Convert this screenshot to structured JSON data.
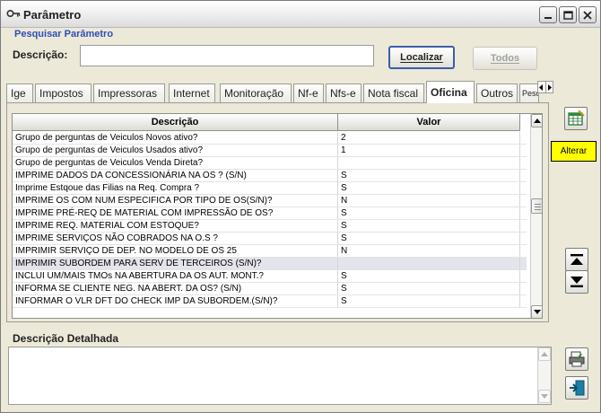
{
  "window": {
    "title": "Parâmetro",
    "icon": "key-icon"
  },
  "search": {
    "section_label": "Pesquisar Parâmetro",
    "description_label": "Descrição:",
    "description_value": "",
    "localizar_label": "Localizar",
    "todos_label": "Todos"
  },
  "tabs": [
    {
      "label": "Ige"
    },
    {
      "label": "Impostos"
    },
    {
      "label": "Impressoras"
    },
    {
      "label": "Internet"
    },
    {
      "label": "Monitoração"
    },
    {
      "label": "Nf-e"
    },
    {
      "label": "Nfs-e"
    },
    {
      "label": "Nota fiscal"
    },
    {
      "label": "Oficina"
    },
    {
      "label": "Outros"
    },
    {
      "label": "Pesqu"
    }
  ],
  "active_tab": "Oficina",
  "grid": {
    "columns": [
      "Descrição",
      "Valor"
    ],
    "rows": [
      {
        "descricao": "Grupo de perguntas de Veiculos Novos ativo?",
        "valor": "2"
      },
      {
        "descricao": "Grupo de perguntas de Veiculos Usados ativo?",
        "valor": "1"
      },
      {
        "descricao": "Grupo de perguntas de Veiculos Venda Direta?",
        "valor": ""
      },
      {
        "descricao": "IMPRIME DADOS DA CONCESSIONÁRIA NA OS ? (S/N)",
        "valor": "S"
      },
      {
        "descricao": "Imprime Estqoue das Filias na Req. Compra ?",
        "valor": "S"
      },
      {
        "descricao": "IMPRIME OS COM NUM ESPECIFICA POR TIPO DE OS(S/N)?",
        "valor": "N"
      },
      {
        "descricao": "IMPRIME PRÉ-REQ DE MATERIAL COM IMPRESSÃO DE OS?",
        "valor": "S"
      },
      {
        "descricao": "IMPRIME REQ. MATERIAL COM ESTOQUE?",
        "valor": "S"
      },
      {
        "descricao": "IMPRIME SERVIÇOS NÃO COBRADOS NA O.S ?",
        "valor": "S"
      },
      {
        "descricao": "IMPRIMIR SERVIÇO DE DEP. NO MODELO DE OS 25",
        "valor": "N"
      },
      {
        "descricao": "IMPRIMIR SUBORDEM PARA SERV DE TERCEIROS (S/N)?",
        "valor": ""
      },
      {
        "descricao": "INCLUI UM/MAIS TMOs NA ABERTURA DA OS AUT. MONT.?",
        "valor": "S"
      },
      {
        "descricao": "INFORMA SE CLIENTE NEG. NA ABERT. DA OS? (S/N)",
        "valor": "S"
      },
      {
        "descricao": "INFORMAR O VLR DFT DO CHECK IMP DA SUBORDEM.(S/N)?",
        "valor": "S"
      }
    ],
    "selected_row": 10
  },
  "side_buttons": {
    "alterar_tooltip": "Alterar"
  },
  "detail": {
    "label": "Descrição Detalhada",
    "value": ""
  }
}
